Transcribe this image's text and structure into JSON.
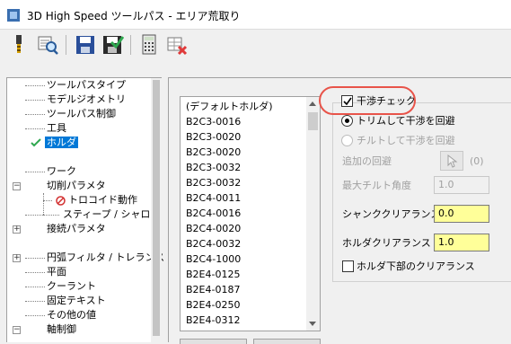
{
  "window": {
    "title": "3D High Speed ツールパス - エリア荒取り",
    "icon": "app-icon"
  },
  "toolbar": {
    "buttons": [
      {
        "name": "tool-icon"
      },
      {
        "name": "preview-magnifier-icon"
      },
      {
        "name": "save-icon"
      },
      {
        "name": "save-green-icon"
      },
      {
        "name": "calculator-icon"
      },
      {
        "name": "delete-table-icon"
      }
    ]
  },
  "tree": {
    "items": [
      {
        "label": "ツールパスタイプ"
      },
      {
        "label": "モデルジオメトリ"
      },
      {
        "label": "ツールパス制御"
      },
      {
        "label": "工具"
      },
      {
        "label": "ホルダ",
        "selected": true
      },
      {
        "label": "ワーク"
      },
      {
        "label": "切削パラメタ"
      },
      {
        "label": "トロコイド動作"
      },
      {
        "label": "スティープ / シャロー"
      },
      {
        "label": "接続パラメタ"
      },
      {
        "label": "円弧フィルタ / トレランス"
      },
      {
        "label": "平面"
      },
      {
        "label": "クーラント"
      },
      {
        "label": "固定テキスト"
      },
      {
        "label": "その他の値"
      },
      {
        "label": "軸制御"
      }
    ]
  },
  "holder_list": {
    "items": [
      "(デフォルトホルダ)",
      "B2C3-0016",
      "B2C3-0020",
      "B2C3-0020",
      "B2C3-0032",
      "B2C3-0032",
      "B2C4-0011",
      "B2C4-0016",
      "B2C4-0020",
      "B2C4-0032",
      "B2C4-1000",
      "B2E4-0125",
      "B2E4-0187",
      "B2E4-0250",
      "B2E4-0312"
    ]
  },
  "interference": {
    "check_label": "干渉チェック",
    "checked": true,
    "radio_trim": "トリムして干渉を回避",
    "radio_tilt": "チルトして干渉を回避",
    "extra_avoid_label": "追加の回避",
    "extra_avoid_count": "(0)",
    "max_tilt_label": "最大チルト角度",
    "max_tilt_value": "1.0",
    "shank_clearance_label": "シャンククリアランス",
    "shank_clearance_value": "0.0",
    "holder_clearance_label": "ホルダクリアランス",
    "holder_clearance_value": "1.0",
    "holder_bottom_label": "ホルダ下部のクリアランス"
  },
  "colors": {
    "selection": "#0078d7",
    "highlight_ring": "#e8544a",
    "input_yellow": "#ffff99"
  }
}
